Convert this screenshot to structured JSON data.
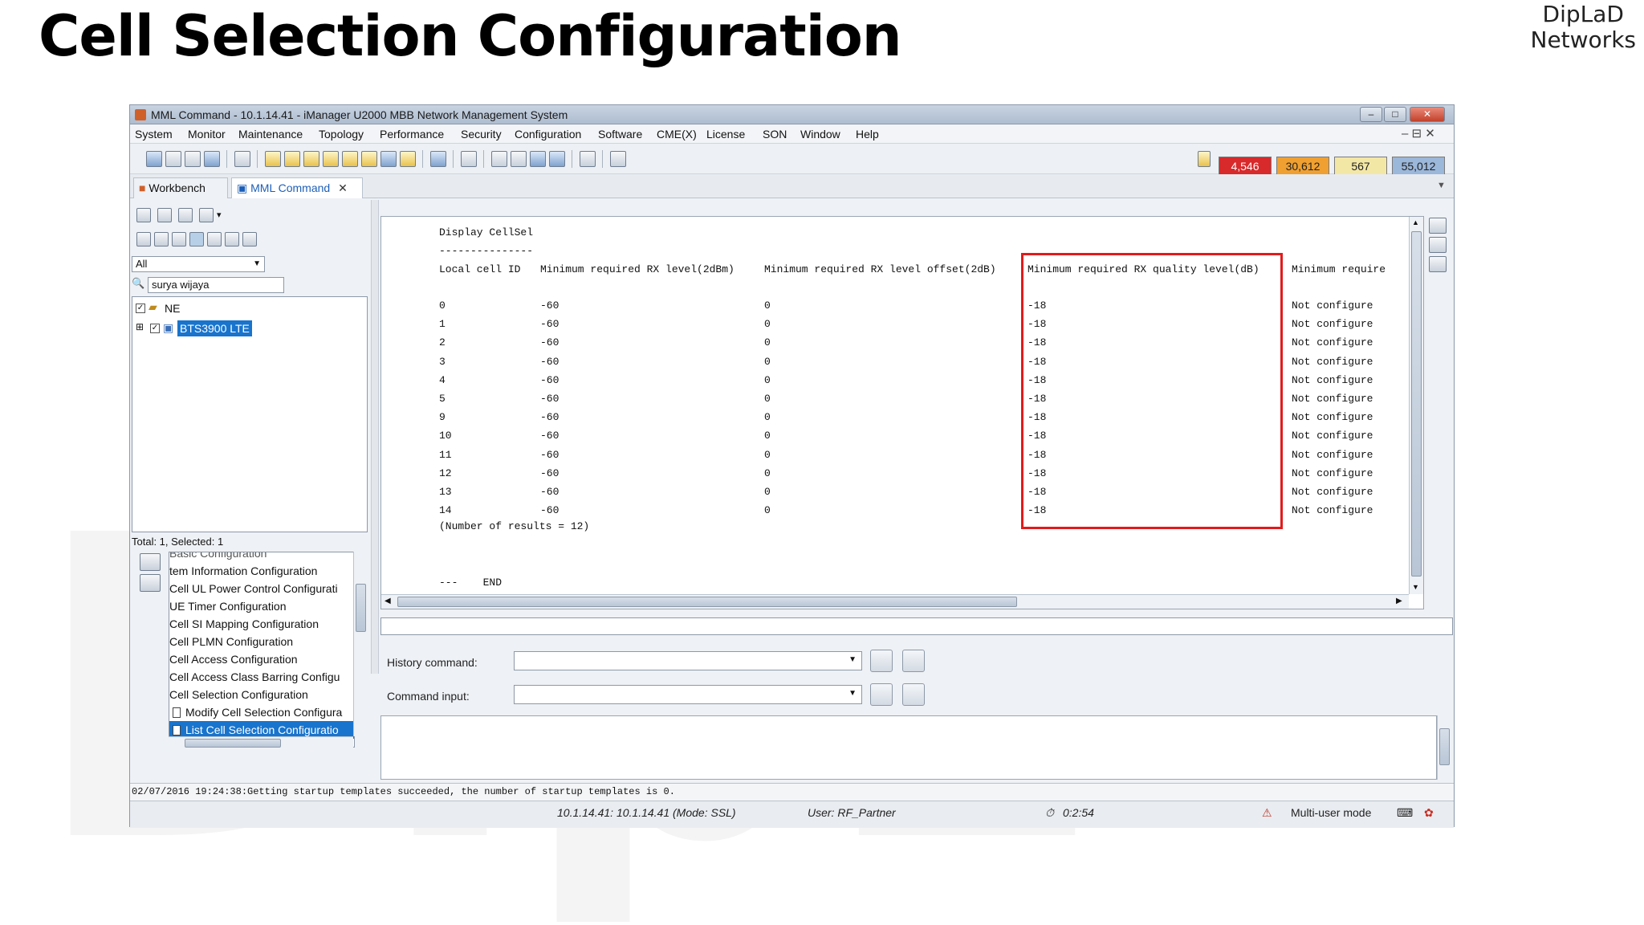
{
  "slide": {
    "title": "Cell Selection Configuration",
    "brand_line1": "DipLaD",
    "brand_line2": "Networks"
  },
  "window": {
    "title": "MML Command - 10.1.14.41 - iManager U2000 MBB Network Management System",
    "controls": {
      "minimize": "–",
      "maximize": "□",
      "close": "✕"
    }
  },
  "menu": {
    "items": [
      "System",
      "Monitor",
      "Maintenance",
      "Topology",
      "Performance",
      "Security",
      "Configuration",
      "Software",
      "CME(X)",
      "License",
      "SON",
      "Window",
      "Help"
    ],
    "mdi_controls": "– ⊟ ✕"
  },
  "alarms": [
    {
      "value": "4,546",
      "color": "#d8292b"
    },
    {
      "value": "30,612",
      "color": "#f0a030"
    },
    {
      "value": "567",
      "color": "#f3e7a6"
    },
    {
      "value": "55,012",
      "color": "#9bb7d9"
    }
  ],
  "tabs": {
    "workbench": "Workbench",
    "mml": "MML Command",
    "close": "✕"
  },
  "left_panel": {
    "filter_value": "All",
    "search_value": "surya wijaya",
    "tree": {
      "root": "NE",
      "child": "BTS3900 LTE"
    },
    "total": "Total: 1, Selected: 1",
    "command_list": [
      "Basic Configuration",
      "tem Information Configuration",
      "Cell UL Power Control Configurati",
      "UE Timer Configuration",
      "Cell SI Mapping Configuration",
      "Cell PLMN Configuration",
      "Cell Access Configuration",
      "Cell Access Class Barring Configu",
      "Cell Selection Configuration",
      "Modify Cell Selection Configura",
      "List Cell Selection Configuratio"
    ]
  },
  "output": {
    "command": "Display CellSel",
    "divider": "---------------",
    "headers": [
      "Local cell ID",
      "Minimum required RX level(2dBm)",
      "Minimum required RX level offset(2dB)",
      "Minimum required RX quality level(dB)",
      "Minimum require"
    ],
    "rows": [
      [
        "0",
        "-60",
        "0",
        "-18",
        "Not configure"
      ],
      [
        "1",
        "-60",
        "0",
        "-18",
        "Not configure"
      ],
      [
        "2",
        "-60",
        "0",
        "-18",
        "Not configure"
      ],
      [
        "3",
        "-60",
        "0",
        "-18",
        "Not configure"
      ],
      [
        "4",
        "-60",
        "0",
        "-18",
        "Not configure"
      ],
      [
        "5",
        "-60",
        "0",
        "-18",
        "Not configure"
      ],
      [
        "9",
        "-60",
        "0",
        "-18",
        "Not configure"
      ],
      [
        "10",
        "-60",
        "0",
        "-18",
        "Not configure"
      ],
      [
        "11",
        "-60",
        "0",
        "-18",
        "Not configure"
      ],
      [
        "12",
        "-60",
        "0",
        "-18",
        "Not configure"
      ],
      [
        "13",
        "-60",
        "0",
        "-18",
        "Not configure"
      ],
      [
        "14",
        "-60",
        "0",
        "-18",
        "Not configure"
      ]
    ],
    "result_count": "(Number of results = 12)",
    "end_marker": "---    END"
  },
  "input_area": {
    "history_label": "History command:",
    "command_label": "Command input:"
  },
  "status_line": "02/07/2016 19:24:38:Getting startup templates succeeded, the number of startup templates is 0.",
  "status_bar": {
    "server": "10.1.14.41: 10.1.14.41 (Mode: SSL)",
    "user": "User: RF_Partner",
    "time": "0:2:54",
    "mode": "Multi-user mode"
  }
}
